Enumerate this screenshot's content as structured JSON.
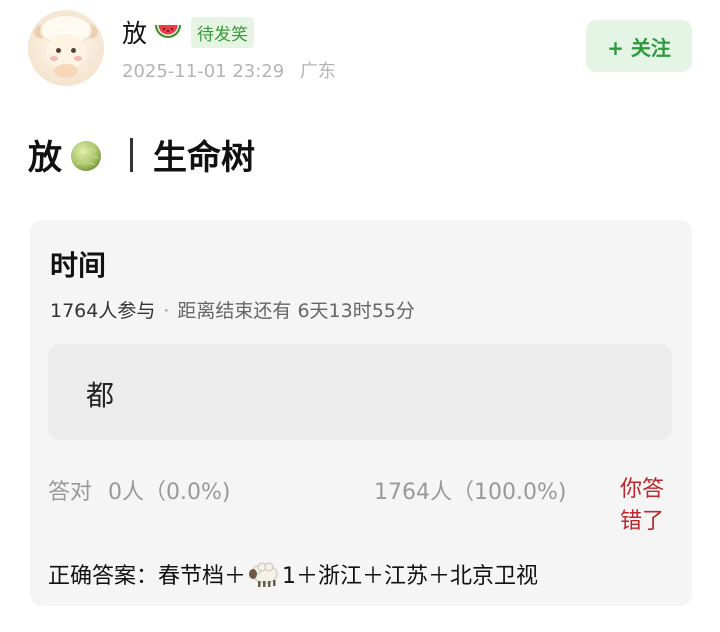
{
  "post": {
    "username": "放",
    "username_emoji": "watermelon-icon",
    "badge": "待发笑",
    "datetime": "2025-11-01 23:29",
    "location": "广东",
    "follow_label": "+ 关注"
  },
  "title": {
    "left": "放",
    "left_emoji": "melon-icon",
    "separator": "|",
    "right": "生命树"
  },
  "poll": {
    "title": "时间",
    "participants": "1764人参与",
    "dot": "·",
    "remaining": "距离结束还有 6天13时55分",
    "option": "都",
    "correct_label": "答对",
    "correct_stats": "0人（0.0%)",
    "total_stats": "1764人（100.0%)",
    "wrong_label": "你答错了",
    "answer_prefix": "正确答案：春节档＋",
    "answer_emoji": "sheep-icon",
    "answer_suffix": "1＋浙江＋江苏＋北京卫视"
  },
  "colors": {
    "badge_bg": "#e6f5e3",
    "badge_text": "#3a9a3a",
    "follow_bg": "#e5f5e5",
    "follow_text": "#2d9a3c",
    "wrong_text": "#c0272d",
    "card_bg": "#f5f5f5"
  }
}
